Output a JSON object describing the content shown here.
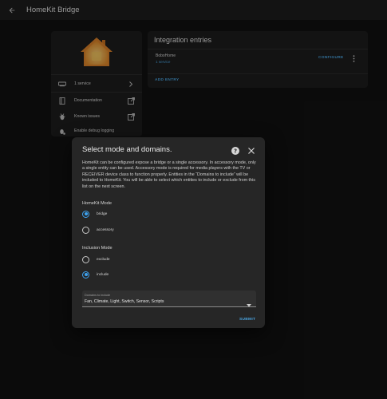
{
  "topbar": {
    "title": "HomeKit Bridge"
  },
  "integration_card": {
    "links": [
      {
        "label": "1 service",
        "icon": "device-icon",
        "trailing": "chevron-right-icon"
      },
      {
        "label": "Documentation",
        "icon": "book-icon",
        "trailing": "open-in-new-icon"
      },
      {
        "label": "Known issues",
        "icon": "bug-icon",
        "trailing": "open-in-new-icon"
      },
      {
        "label": "Enable debug logging",
        "icon": "debug-icon",
        "trailing": ""
      }
    ]
  },
  "entries": {
    "title": "Integration entries",
    "items": [
      {
        "name": "BoboHome",
        "subtitle": "1 service",
        "action": "CONFIGURE"
      }
    ],
    "add_label": "ADD ENTRY"
  },
  "dialog": {
    "title": "Select mode and domains.",
    "description": "HomeKit can be configured expose a bridge or a single accessory. In accessory mode, only a single entity can be used. Accessory mode is required for media players with the TV or RECEIVER device class to function properly. Entities in the “Domains to include” will be included to HomeKit. You will be able to select which entities to include or exclude from this list on the next screen.",
    "homekit_mode": {
      "label": "HomeKit Mode",
      "options": [
        {
          "label": "bridge",
          "checked": true
        },
        {
          "label": "accessory",
          "checked": false
        }
      ]
    },
    "inclusion_mode": {
      "label": "Inclusion Mode",
      "options": [
        {
          "label": "exclude",
          "checked": false
        },
        {
          "label": "include",
          "checked": true
        }
      ]
    },
    "domains": {
      "label": "Domains to include",
      "value": "Fan, Climate, Light, Switch, Sensor, Scripts"
    },
    "submit_label": "SUBMIT"
  },
  "colors": {
    "accent": "#3da2ef",
    "link": "#4aa3df",
    "background": "#111111",
    "card": "#1c1c1c",
    "dialog": "#262626"
  }
}
